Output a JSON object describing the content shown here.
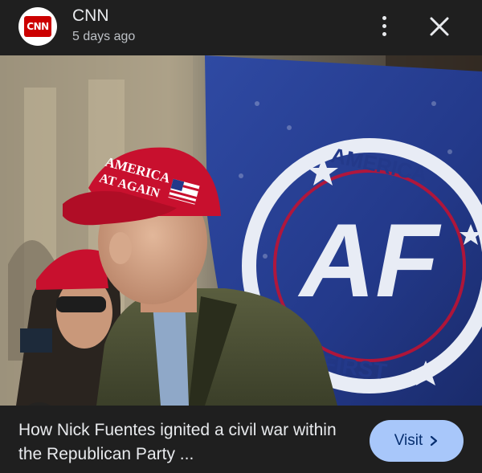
{
  "header": {
    "source_logo_text": "CNN",
    "source_name": "CNN",
    "time_ago": "5 days ago",
    "more_icon": "more-vert-icon",
    "close_icon": "close-icon"
  },
  "image": {
    "hat_text_line1": "AMERICA",
    "hat_text_line2": "AT AGAIN",
    "flag_letters": "AF",
    "flag_top_text": "AMERICA",
    "flag_bottom_text": "FIRST",
    "lens_icon": "google-lens-icon"
  },
  "footer": {
    "headline": "How Nick Fuentes ignited a civil war within the Republican Party ...",
    "visit_label": "Visit",
    "visit_icon": "chevron-right-icon"
  },
  "colors": {
    "background": "#1f1f1f",
    "visit_button": "#a8c7fa",
    "visit_text": "#062e6f",
    "cnn_red": "#cc0000",
    "hat_red": "#c8102e",
    "flag_blue": "#233a8c"
  }
}
